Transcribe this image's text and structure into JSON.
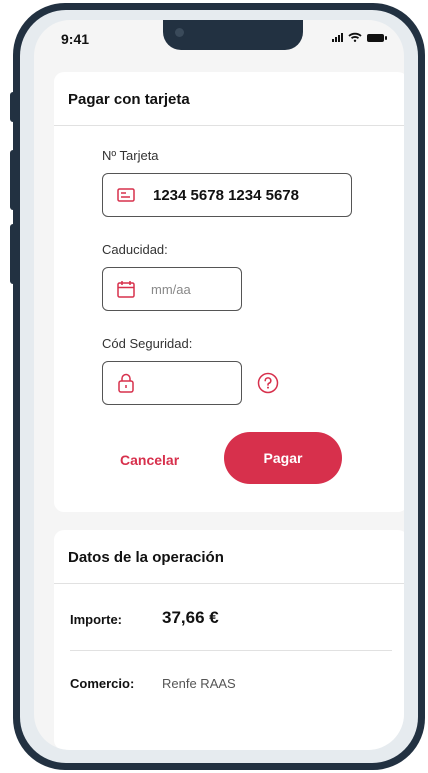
{
  "status_bar": {
    "time": "9:41"
  },
  "payment_card": {
    "title": "Pagar con tarjeta",
    "card_number": {
      "label": "Nº Tarjeta",
      "value": "1234 5678 1234 5678",
      "icon": "credit-card-icon"
    },
    "expiry": {
      "label": "Caducidad:",
      "placeholder": "mm/aa",
      "icon": "calendar-icon"
    },
    "security_code": {
      "label": "Cód Seguridad:",
      "value": "",
      "icon": "lock-icon",
      "help_icon": "help-circle-icon"
    },
    "cancel_label": "Cancelar",
    "pay_label": "Pagar"
  },
  "operation": {
    "title": "Datos de la operación",
    "amount_label": "Importe:",
    "amount_value": "37,66 €",
    "merchant_label": "Comercio:",
    "merchant_value": "Renfe RAAS"
  },
  "colors": {
    "accent": "#d7304c",
    "frame": "#223141",
    "background": "#f5f5f5"
  }
}
